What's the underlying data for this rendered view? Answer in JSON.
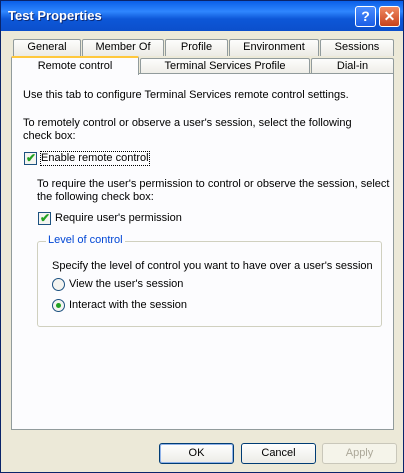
{
  "window": {
    "title": "Test Properties",
    "help_glyph": "?",
    "close_glyph": "✕"
  },
  "tabs": {
    "row1": [
      "General",
      "Member Of",
      "Profile",
      "Environment",
      "Sessions"
    ],
    "row2": [
      "Remote control",
      "Terminal Services Profile",
      "Dial-in"
    ],
    "active": "Remote control"
  },
  "panel": {
    "intro": "Use this tab to configure Terminal Services remote control settings.",
    "remote_instruction_line1": "To remotely control or observe a user's session, select the following",
    "remote_instruction_line2": "check box:",
    "enable_remote_control": {
      "label": "Enable remote control",
      "checked": true
    },
    "permission_instruction_line1": "To require the user's permission to control or observe the session, select",
    "permission_instruction_line2": "the following check box:",
    "require_permission": {
      "label": "Require user's permission",
      "checked": true
    },
    "level_of_control": {
      "title": "Level of control",
      "description": "Specify the level of control you want to have over a user's session",
      "options": [
        {
          "label": "View the user's session",
          "selected": false
        },
        {
          "label": "Interact with the session",
          "selected": true
        }
      ]
    }
  },
  "buttons": {
    "ok": "OK",
    "cancel": "Cancel",
    "apply": "Apply"
  },
  "icons": {
    "check": "✔"
  },
  "colors": {
    "title_bar": "#0a5fe8",
    "accent_tab": "#ffc83c",
    "group_title": "#0046d5",
    "check": "#21a121"
  }
}
